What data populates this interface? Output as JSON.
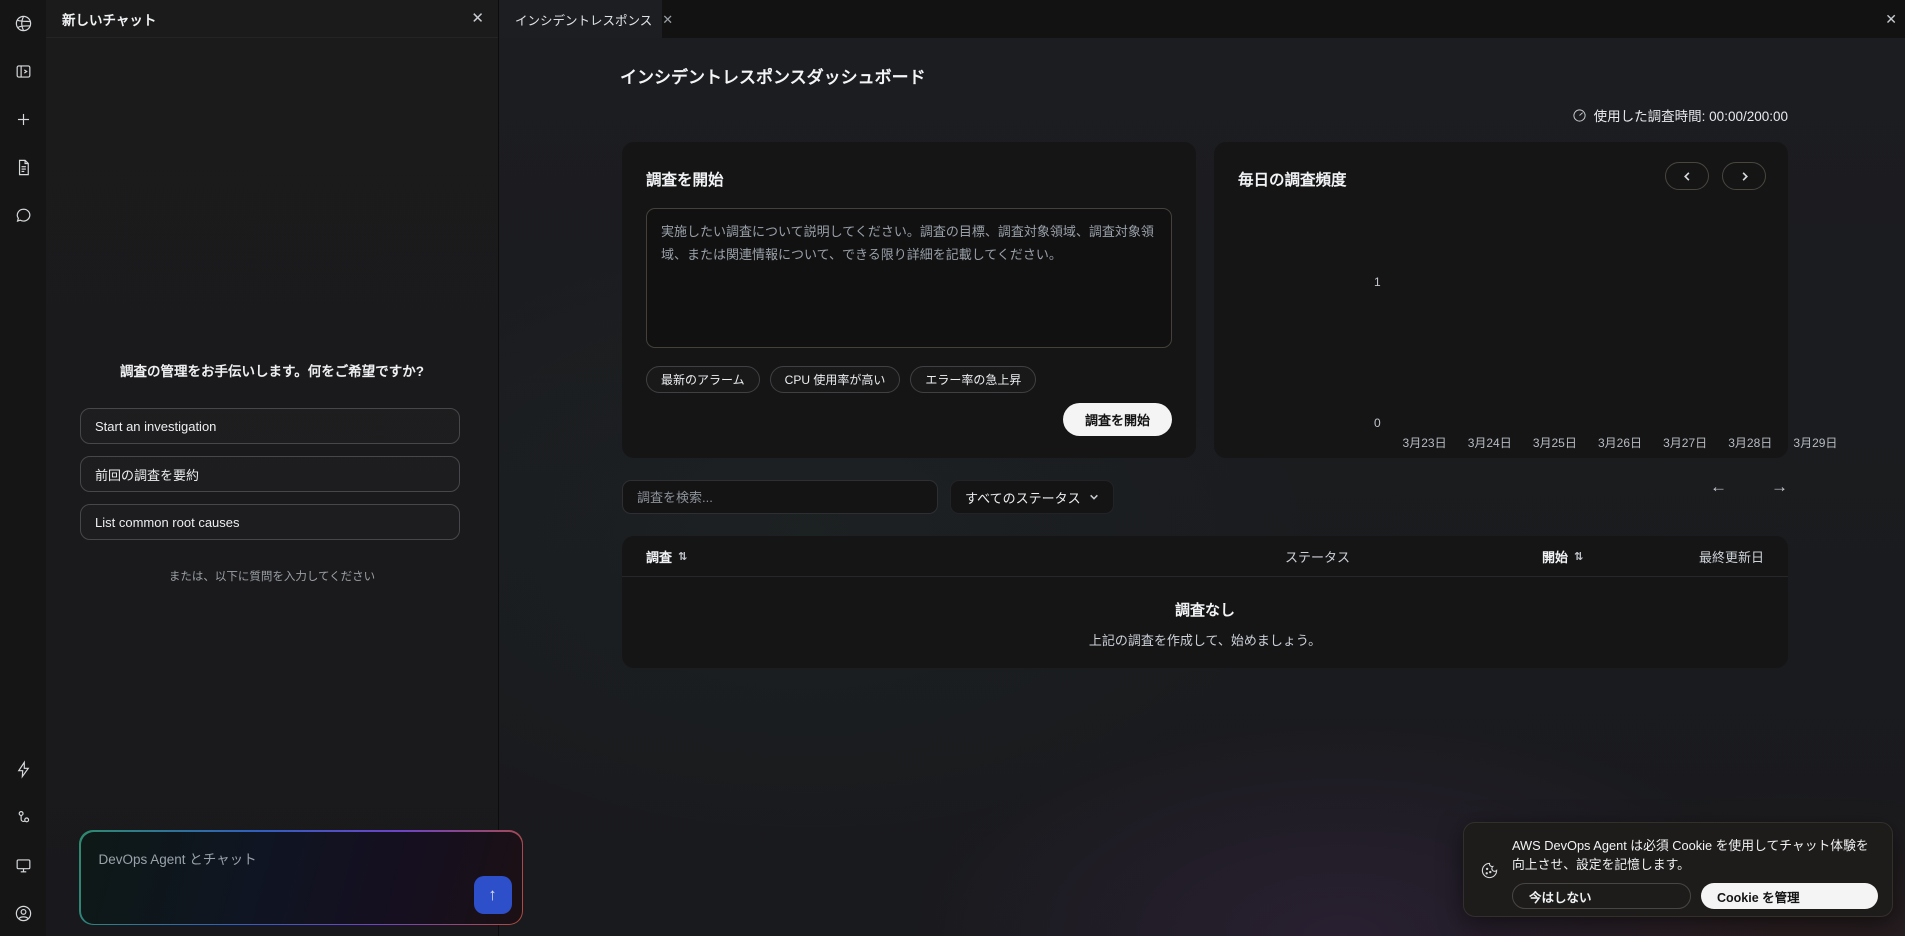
{
  "rail": {
    "icons": [
      "logo-icon",
      "panel-toggle-icon",
      "plus-icon",
      "document-icon",
      "chat-bubble-icon",
      "lightning-icon",
      "workflow-icon",
      "monitor-icon",
      "account-icon"
    ]
  },
  "chat": {
    "title": "新しいチャット",
    "close": "✕",
    "greeting": "調査の管理をお手伝いします。何をご希望ですか?",
    "suggestions": [
      "Start an investigation",
      "前回の調査を要約",
      "List common root causes"
    ],
    "or_hint": "または、以下に質問を入力してください",
    "input_placeholder": "DevOps Agent とチャット",
    "send": "↑"
  },
  "tabs": {
    "active_label": "インシデントレスポンス",
    "close": "✕",
    "window_close": "✕"
  },
  "dashboard": {
    "title": "インシデントレスポンスダッシュボード",
    "time_used": "使用した調査時間: 00:00/200:00",
    "start_card": {
      "title": "調査を開始",
      "placeholder": "実施したい調査について説明してください。調査の目標、調査対象領域、調査対象領域、または関連情報について、できる限り詳細を記載してください。",
      "chips": [
        "最新のアラーム",
        "CPU 使用率が高い",
        "エラー率の急上昇"
      ],
      "submit": "調査を開始"
    },
    "filter": {
      "search_placeholder": "調査を検索...",
      "status_filter": "すべてのステータス",
      "prev_arrow": "←",
      "next_arrow": "→"
    },
    "table": {
      "columns": {
        "investigation": "調査",
        "status": "ステータス",
        "start": "開始",
        "updated": "最終更新日"
      },
      "sort_glyph": "⇅",
      "empty_title": "調査なし",
      "empty_subtitle": "上記の調査を作成して、始めましょう。"
    }
  },
  "chart_data": {
    "type": "bar",
    "title": "毎日の調査頻度",
    "categories": [
      "3月23日",
      "3月24日",
      "3月25日",
      "3月26日",
      "3月27日",
      "3月28日",
      "3月29日"
    ],
    "values": [
      0,
      0,
      0,
      0,
      0,
      0,
      0
    ],
    "xlabel": "",
    "ylabel": "",
    "ylim": [
      0,
      1
    ],
    "yticks": [
      "1",
      "0"
    ],
    "grid": false,
    "legend": false
  },
  "cookie_banner": {
    "message": "AWS DevOps Agent は必須 Cookie を使用してチャット体験を向上させ、設定を記憶します。",
    "dismiss": "今はしない",
    "manage": "Cookie を管理"
  },
  "colors": {
    "accent_blue": "#2e4fca",
    "gradient_teal": "#2e8a6e",
    "gradient_red": "#b14a3e",
    "card_bg": "#151516",
    "primary_button": "#f4f4f4"
  }
}
